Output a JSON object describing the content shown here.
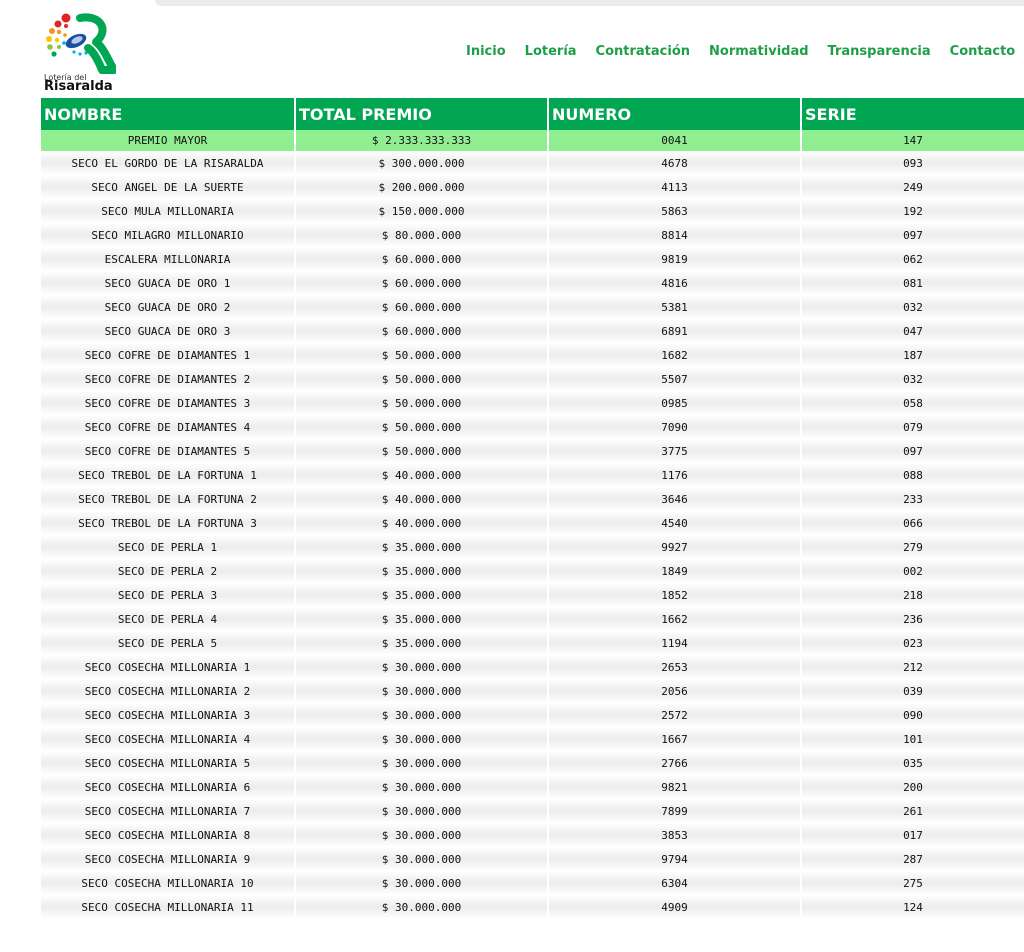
{
  "brand": {
    "small": "Lotería del",
    "big": "Risaralda"
  },
  "nav": [
    "Inicio",
    "Lotería",
    "Contratación",
    "Normatividad",
    "Transparencia",
    "Contacto"
  ],
  "table": {
    "headers": [
      "NOMBRE",
      "TOTAL PREMIO",
      "NUMERO",
      "SERIE"
    ],
    "rows": [
      [
        "PREMIO MAYOR",
        "$ 2.333.333.333",
        "0041",
        "147"
      ],
      [
        "SECO EL GORDO DE LA RISARALDA",
        "$ 300.000.000",
        "4678",
        "093"
      ],
      [
        "SECO ANGEL DE LA SUERTE",
        "$ 200.000.000",
        "4113",
        "249"
      ],
      [
        "SECO MULA MILLONARIA",
        "$ 150.000.000",
        "5863",
        "192"
      ],
      [
        "SECO MILAGRO MILLONARIO",
        "$ 80.000.000",
        "8814",
        "097"
      ],
      [
        "ESCALERA MILLONARIA",
        "$ 60.000.000",
        "9819",
        "062"
      ],
      [
        "SECO GUACA DE ORO 1",
        "$ 60.000.000",
        "4816",
        "081"
      ],
      [
        "SECO GUACA DE ORO 2",
        "$ 60.000.000",
        "5381",
        "032"
      ],
      [
        "SECO GUACA DE ORO 3",
        "$ 60.000.000",
        "6891",
        "047"
      ],
      [
        "SECO COFRE DE DIAMANTES 1",
        "$ 50.000.000",
        "1682",
        "187"
      ],
      [
        "SECO COFRE DE DIAMANTES 2",
        "$ 50.000.000",
        "5507",
        "032"
      ],
      [
        "SECO COFRE DE DIAMANTES 3",
        "$ 50.000.000",
        "0985",
        "058"
      ],
      [
        "SECO COFRE DE DIAMANTES 4",
        "$ 50.000.000",
        "7090",
        "079"
      ],
      [
        "SECO COFRE DE DIAMANTES 5",
        "$ 50.000.000",
        "3775",
        "097"
      ],
      [
        "SECO TREBOL DE LA FORTUNA 1",
        "$ 40.000.000",
        "1176",
        "088"
      ],
      [
        "SECO TREBOL DE LA FORTUNA 2",
        "$ 40.000.000",
        "3646",
        "233"
      ],
      [
        "SECO TREBOL DE LA FORTUNA 3",
        "$ 40.000.000",
        "4540",
        "066"
      ],
      [
        "SECO DE PERLA 1",
        "$ 35.000.000",
        "9927",
        "279"
      ],
      [
        "SECO DE PERLA 2",
        "$ 35.000.000",
        "1849",
        "002"
      ],
      [
        "SECO DE PERLA 3",
        "$ 35.000.000",
        "1852",
        "218"
      ],
      [
        "SECO DE PERLA 4",
        "$ 35.000.000",
        "1662",
        "236"
      ],
      [
        "SECO DE PERLA 5",
        "$ 35.000.000",
        "1194",
        "023"
      ],
      [
        "SECO COSECHA MILLONARIA 1",
        "$ 30.000.000",
        "2653",
        "212"
      ],
      [
        "SECO COSECHA MILLONARIA 2",
        "$ 30.000.000",
        "2056",
        "039"
      ],
      [
        "SECO COSECHA MILLONARIA 3",
        "$ 30.000.000",
        "2572",
        "090"
      ],
      [
        "SECO COSECHA MILLONARIA 4",
        "$ 30.000.000",
        "1667",
        "101"
      ],
      [
        "SECO COSECHA MILLONARIA 5",
        "$ 30.000.000",
        "2766",
        "035"
      ],
      [
        "SECO COSECHA MILLONARIA 6",
        "$ 30.000.000",
        "9821",
        "200"
      ],
      [
        "SECO COSECHA MILLONARIA 7",
        "$ 30.000.000",
        "7899",
        "261"
      ],
      [
        "SECO COSECHA MILLONARIA 8",
        "$ 30.000.000",
        "3853",
        "017"
      ],
      [
        "SECO COSECHA MILLONARIA 9",
        "$ 30.000.000",
        "9794",
        "287"
      ],
      [
        "SECO COSECHA MILLONARIA 10",
        "$ 30.000.000",
        "6304",
        "275"
      ],
      [
        "SECO COSECHA MILLONARIA 11",
        "$ 30.000.000",
        "4909",
        "124"
      ]
    ]
  },
  "colors": {
    "header_green": "#00a651",
    "nav_green": "#1f9e4a",
    "highlight_row": "#90ee90"
  }
}
